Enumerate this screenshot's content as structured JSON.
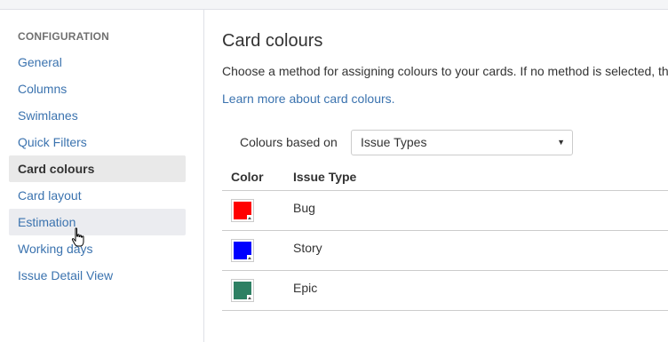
{
  "sidebar": {
    "heading": "CONFIGURATION",
    "items": [
      {
        "label": "General"
      },
      {
        "label": "Columns"
      },
      {
        "label": "Swimlanes"
      },
      {
        "label": "Quick Filters"
      },
      {
        "label": "Card colours"
      },
      {
        "label": "Card layout"
      },
      {
        "label": "Estimation"
      },
      {
        "label": "Working days"
      },
      {
        "label": "Issue Detail View"
      }
    ],
    "active_item": "Card colours",
    "hovered_item": "Estimation"
  },
  "main": {
    "title": "Card colours",
    "description": "Choose a method for assigning colours to your cards. If no method is selected, th",
    "learn_more": "Learn more about card colours.",
    "colours_based_on_label": "Colours based on",
    "colours_based_on_value": "Issue Types",
    "table": {
      "headers": {
        "color": "Color",
        "issue_type": "Issue Type"
      },
      "rows": [
        {
          "issue_type": "Bug",
          "color": "#ff0000"
        },
        {
          "issue_type": "Story",
          "color": "#0000ff"
        },
        {
          "issue_type": "Epic",
          "color": "#2e8063"
        }
      ]
    }
  },
  "icons": {
    "select_arrow": "chevron-down-icon",
    "swatch_arrow": "caret-up-icon",
    "cursor": "hand-pointer-cursor"
  }
}
